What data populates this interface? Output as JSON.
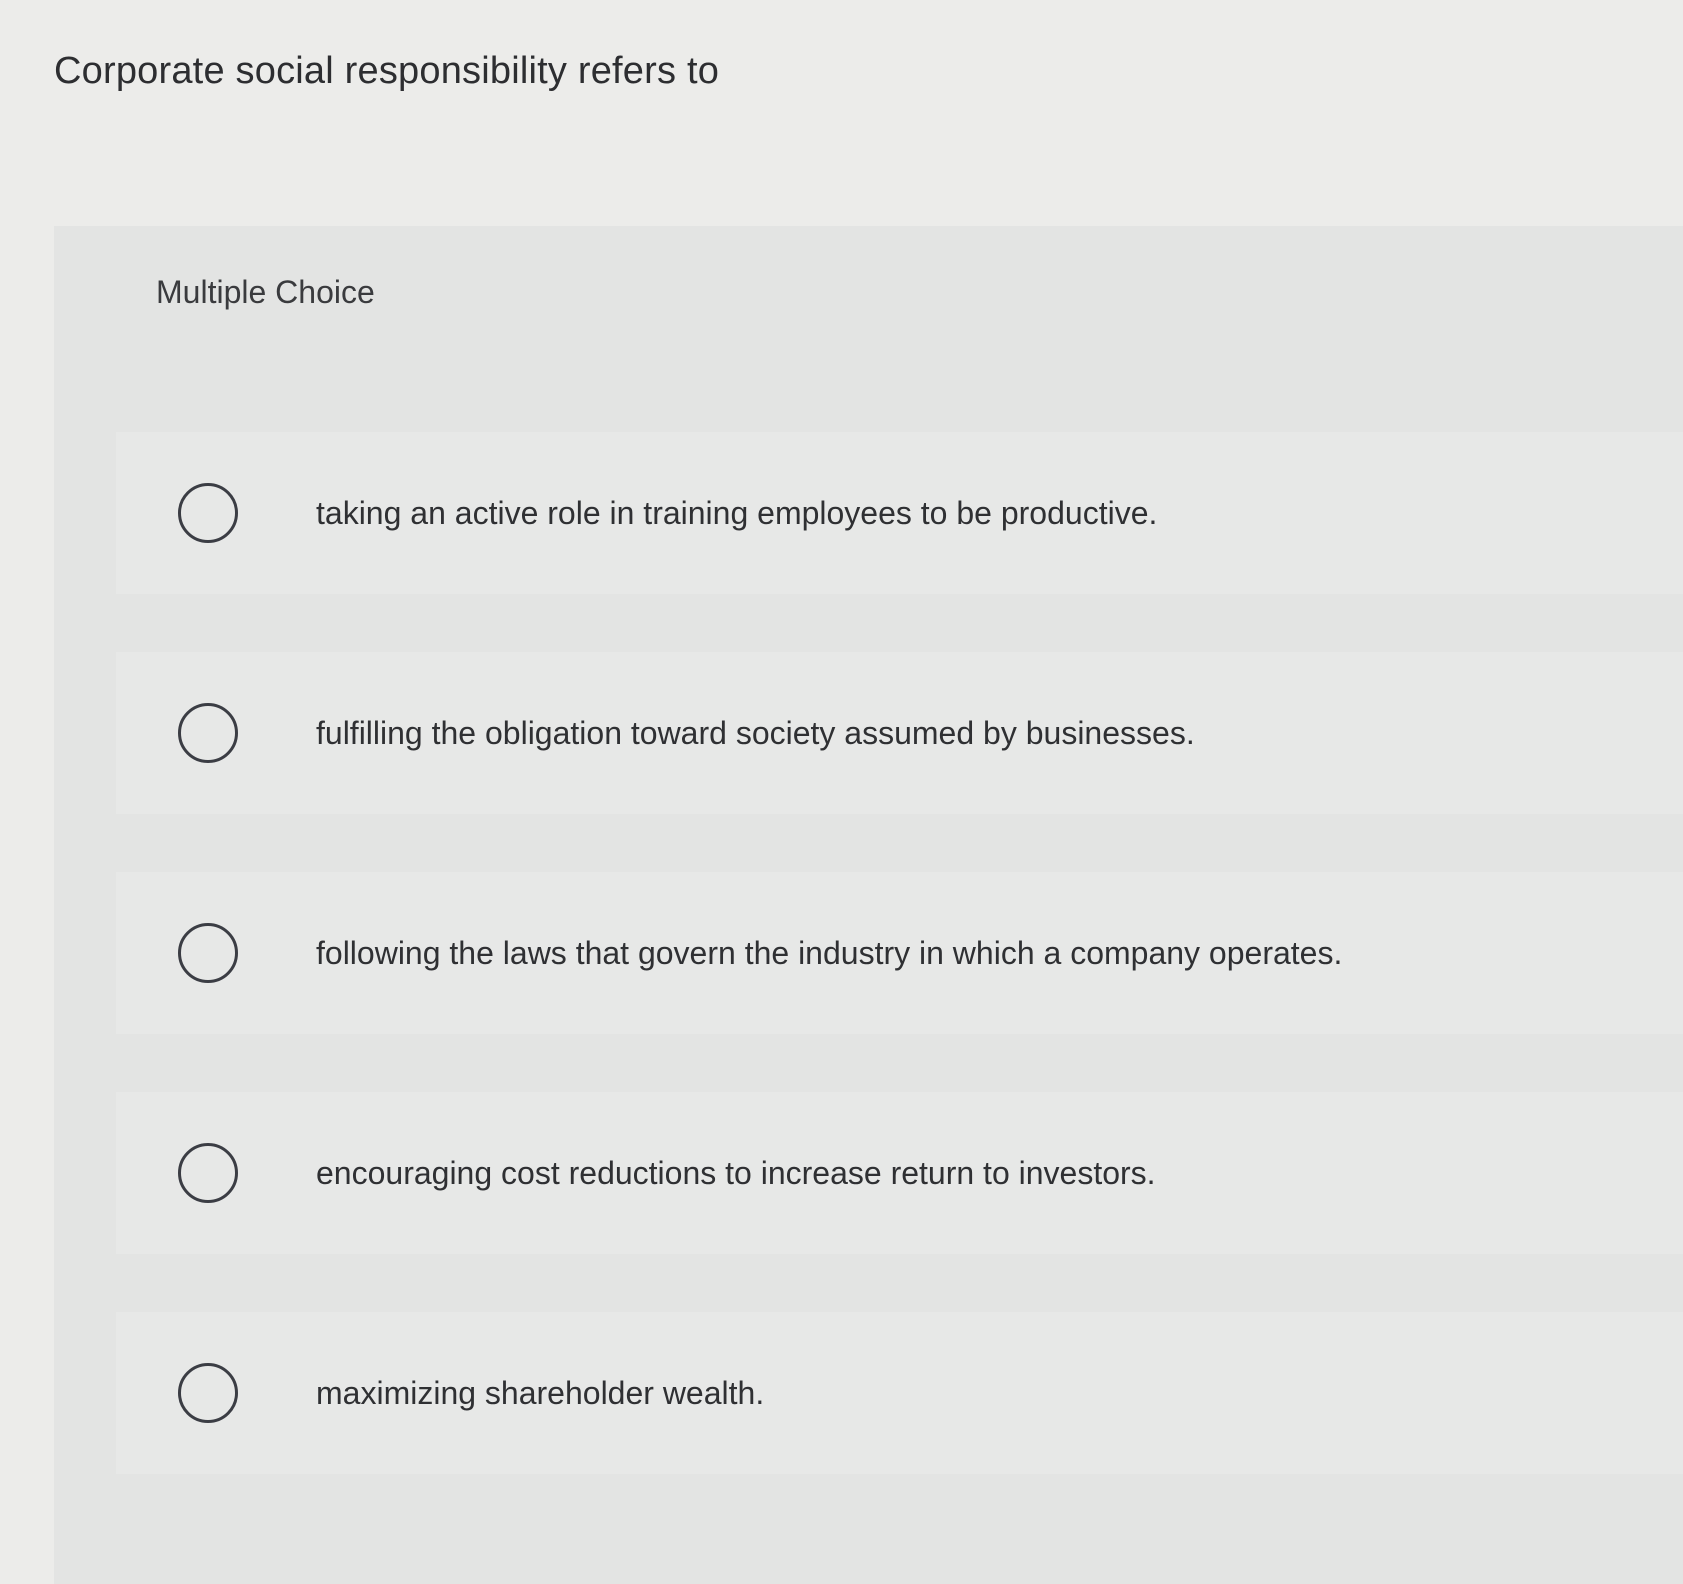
{
  "question": {
    "text": "Corporate social responsibility refers to"
  },
  "multiple_choice": {
    "label": "Multiple Choice",
    "options": [
      {
        "text": "taking an active role in training employees to be productive."
      },
      {
        "text": "fulfilling the obligation toward society assumed by businesses."
      },
      {
        "text": "following the laws that govern the industry in which a company operates."
      },
      {
        "text": "encouraging cost reductions to increase return to investors."
      },
      {
        "text": "maximizing shareholder wealth."
      }
    ]
  },
  "colors": {
    "background": "#ececea",
    "panel": "#e3e4e3",
    "text": "#2f3033",
    "radio_border": "#3b3d44"
  }
}
